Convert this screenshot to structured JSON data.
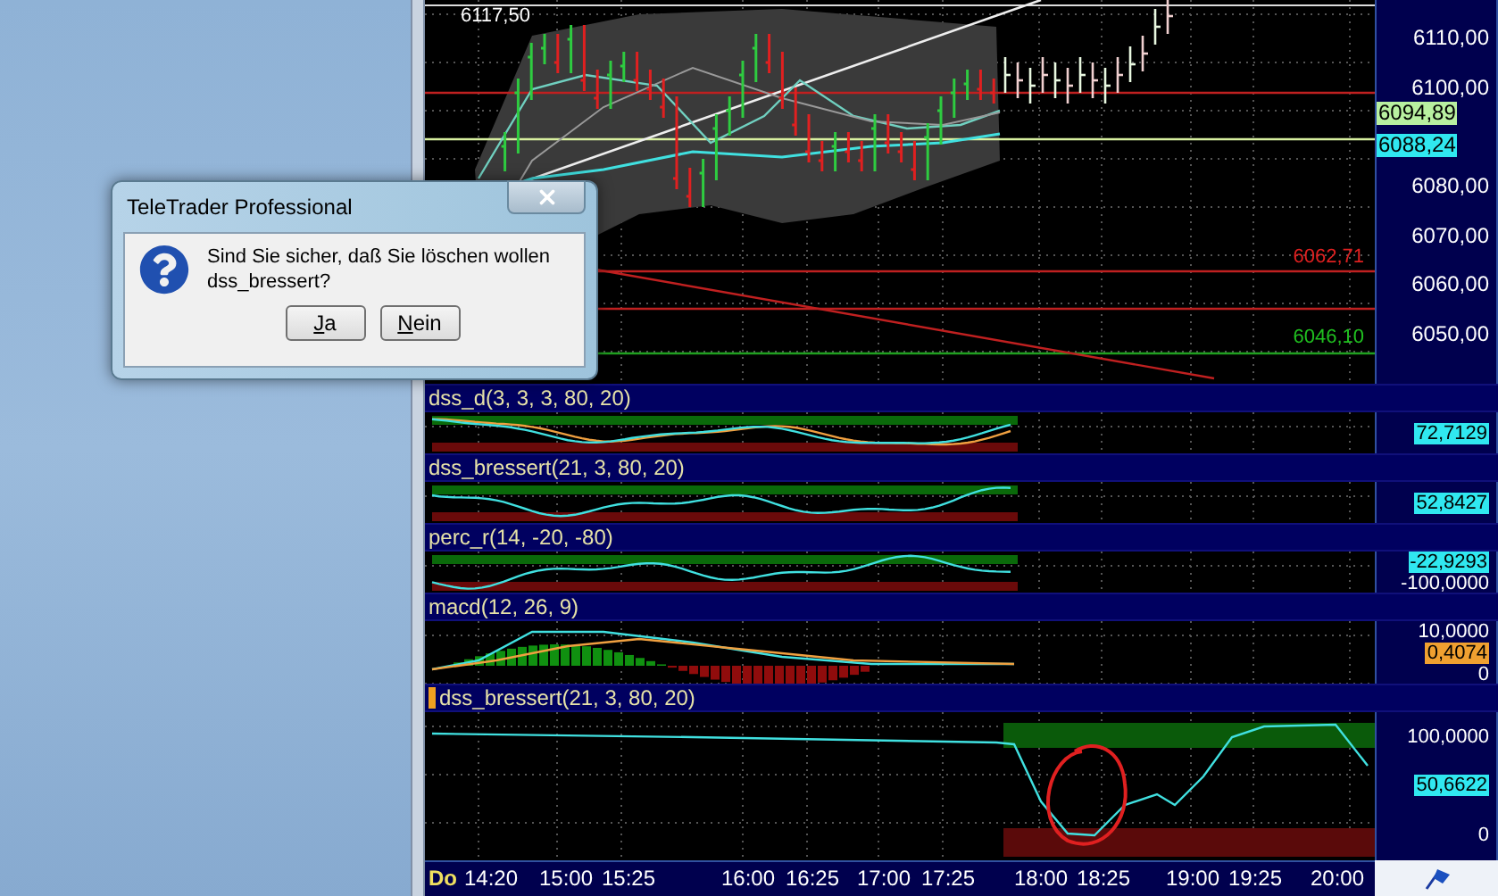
{
  "dialog": {
    "title": "TeleTrader Professional",
    "message": "Sind Sie sicher, daß Sie löschen wollen\ndss_bressert?",
    "buttons": [
      {
        "label": "Ja"
      },
      {
        "label": "Nein"
      }
    ]
  },
  "price_panel": {
    "labels": [
      {
        "text": "6117,50",
        "color": "#ffffff"
      },
      {
        "text": "6062,71",
        "color": "#e02020"
      },
      {
        "text": "6046,10",
        "color": "#20c020"
      }
    ],
    "axis_ticks": [
      "6110,00",
      "6100,00",
      "6080,00",
      "6070,00",
      "6060,00",
      "6050,00"
    ],
    "badges": [
      {
        "text": "6094,89",
        "color": "#b8f0a0"
      },
      {
        "text": "6088,24",
        "color": "#30e8f0"
      }
    ]
  },
  "indicator_panels": [
    {
      "title": "dss_d(3, 3, 3, 80, 20)",
      "kind": "dual_oscillator",
      "selected": false,
      "axis_labels": [
        {
          "text": "72,7129",
          "kind": "badge",
          "color": "#30e8f0"
        }
      ]
    },
    {
      "title": "dss_bressert(21, 3, 80, 20)",
      "kind": "oscillator",
      "selected": false,
      "axis_labels": [
        {
          "text": "52,8427",
          "kind": "badge",
          "color": "#30e8f0"
        }
      ]
    },
    {
      "title": "perc_r(14, -20, -80)",
      "kind": "oscillator",
      "selected": false,
      "axis_labels": [
        {
          "text": "-22,9293",
          "kind": "badge",
          "color": "#30e8f0"
        },
        {
          "text": "-100,0000",
          "kind": "tick"
        }
      ]
    },
    {
      "title": "macd(12, 26, 9)",
      "kind": "macd",
      "selected": false,
      "axis_labels": [
        {
          "text": "10,0000",
          "kind": "tick"
        },
        {
          "text": "0,4074",
          "kind": "badge",
          "color": "#f0a030"
        },
        {
          "text": "0",
          "kind": "tick"
        }
      ]
    },
    {
      "title": "dss_bressert(21, 3, 80, 20)",
      "kind": "oscillator",
      "selected": true,
      "axis_labels": [
        {
          "text": "100,0000",
          "kind": "tick"
        },
        {
          "text": "50,6622",
          "kind": "badge",
          "color": "#30e8f0"
        },
        {
          "text": "0",
          "kind": "tick"
        }
      ]
    }
  ],
  "time_axis": {
    "day": "Do",
    "times": [
      "14:20",
      "15:00",
      "15:25",
      "16:00",
      "16:25",
      "17:00",
      "17:25",
      "18:00",
      "18:25",
      "19:00",
      "19:25",
      "20:00"
    ]
  }
}
